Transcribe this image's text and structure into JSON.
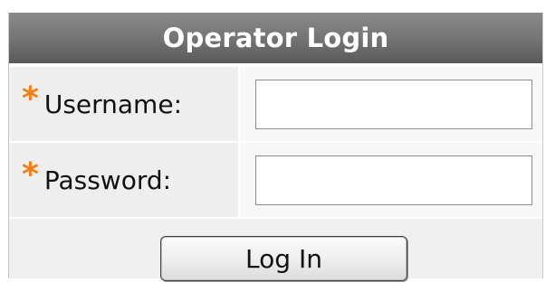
{
  "panel": {
    "title": "Operator Login"
  },
  "fields": {
    "username": {
      "required_marker": "*",
      "label": "Username:",
      "value": "",
      "placeholder": ""
    },
    "password": {
      "required_marker": "*",
      "label": "Password:",
      "value": "",
      "placeholder": ""
    }
  },
  "actions": {
    "login_label": "Log In"
  },
  "colors": {
    "required_marker": "#f47d14",
    "header_background": "#777777",
    "row_background": "#eeeeee"
  }
}
